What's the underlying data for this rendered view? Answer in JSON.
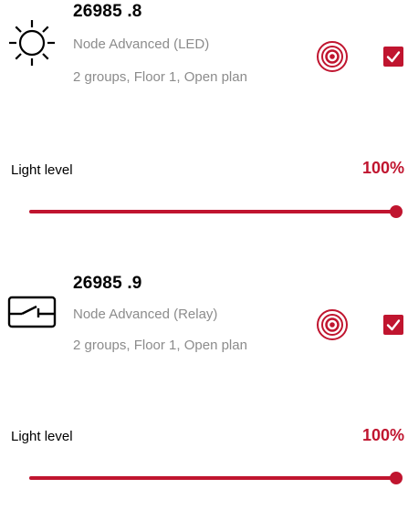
{
  "colors": {
    "accent": "#c0152f",
    "secondary_text": "#8c8c8c",
    "track": "#e2e2e2"
  },
  "nodes": [
    {
      "name": "26985 .8",
      "type": "Node Advanced (LED)",
      "location": "2 groups, Floor 1, Open plan",
      "icon": "light-bulb-icon",
      "selected": true,
      "light_level_label": "Light level",
      "light_level_value": "100%",
      "light_level": 1.0
    },
    {
      "name": "26985 .9",
      "type": "Node Advanced (Relay)",
      "location": "2 groups, Floor 1, Open plan",
      "icon": "relay-switch-icon",
      "selected": true,
      "light_level_label": "Light level",
      "light_level_value": "100%",
      "light_level": 1.0
    }
  ]
}
